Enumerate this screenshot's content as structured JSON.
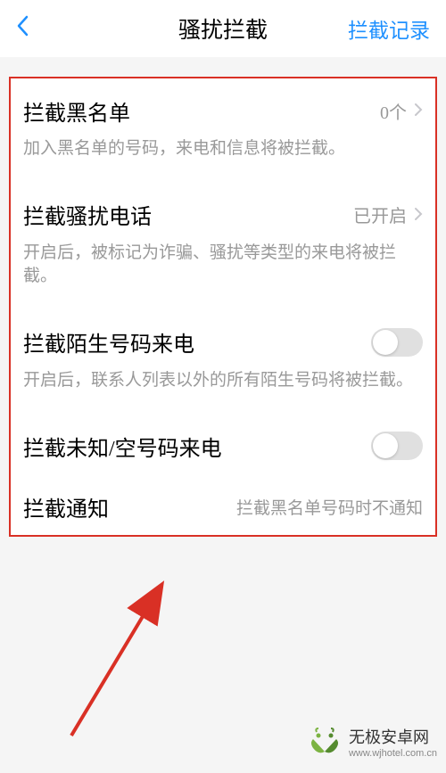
{
  "header": {
    "title": "骚扰拦截",
    "action": "拦截记录"
  },
  "items": {
    "blacklist": {
      "title": "拦截黑名单",
      "value": "0个",
      "desc": "加入黑名单的号码，来电和信息将被拦截。"
    },
    "harass": {
      "title": "拦截骚扰电话",
      "value": "已开启",
      "desc": "开启后，被标记为诈骗、骚扰等类型的来电将被拦截。"
    },
    "stranger": {
      "title": "拦截陌生号码来电",
      "desc": "开启后，联系人列表以外的所有陌生号码将被拦截。"
    },
    "unknown": {
      "title": "拦截未知/空号码来电"
    },
    "notify": {
      "title": "拦截通知",
      "value": "拦截黑名单号码时不通知"
    }
  },
  "watermark": {
    "name": "无极安卓网",
    "url": "www.wjhotel.com.cn"
  }
}
